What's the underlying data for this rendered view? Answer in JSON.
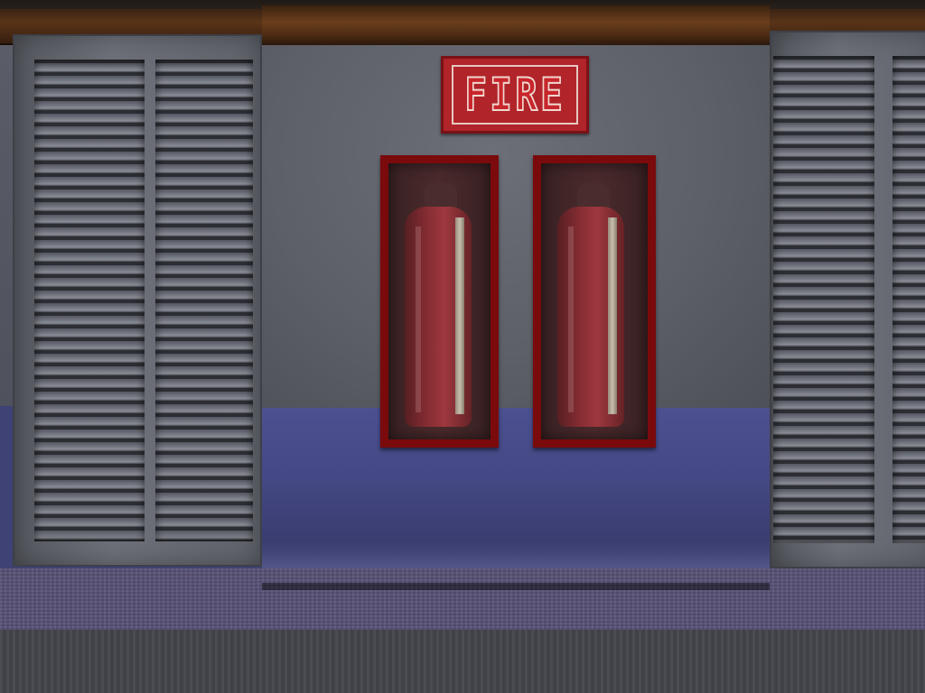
{
  "scene": {
    "sign": {
      "text": "FIRE"
    },
    "cabinets": [
      {
        "content": "fire-extinguisher"
      },
      {
        "content": "fire-extinguisher"
      }
    ],
    "colors": {
      "sign_red": "#b0242a",
      "cabinet_frame": "#7a0a0c",
      "wall_lower_blue": "#444884",
      "trim_wood": "#5a3418"
    }
  }
}
